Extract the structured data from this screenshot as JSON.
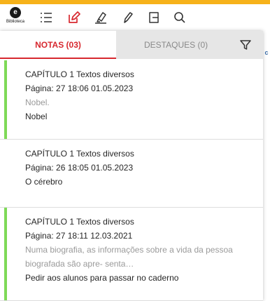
{
  "app": {
    "logo_letter": "e",
    "logo_label": "Biblioteca"
  },
  "toolbar": {
    "icons": [
      "list-icon",
      "edit-note-icon",
      "highlighter-icon",
      "pencil-icon",
      "bookmark-icon",
      "search-icon"
    ]
  },
  "tabs": {
    "notes_label": "NOTAS (03)",
    "highlights_label": "DESTAQUES (0)"
  },
  "colors": {
    "accent_red": "#d7282f",
    "top_bar": "#f6b21a",
    "bar_green": "#7ed957"
  },
  "notes": [
    {
      "chapter": "CAPÍTULO 1 Textos diversos",
      "page_line": "Página: 27  18:06 01.05.2023",
      "quote": "Nobel.",
      "note": "Nobel",
      "bar_color": "#7ed957"
    },
    {
      "chapter": "CAPÍTULO 1 Textos diversos",
      "page_line": "Página: 26  18:05 01.05.2023",
      "quote": "",
      "note": "O cérebro",
      "bar_color": "#ffffff"
    },
    {
      "chapter": "CAPÍTULO 1 Textos diversos",
      "page_line": "Página: 27  18:11 12.03.2021",
      "quote_line1": "Numa biografia, as informações sobre a vida da pessoa",
      "quote_line2": "biografada são apre- senta…",
      "note": "Pedir aos alunos para passar no caderno",
      "bar_color": "#7ed957"
    }
  ],
  "peek": {
    "text": "s c"
  }
}
